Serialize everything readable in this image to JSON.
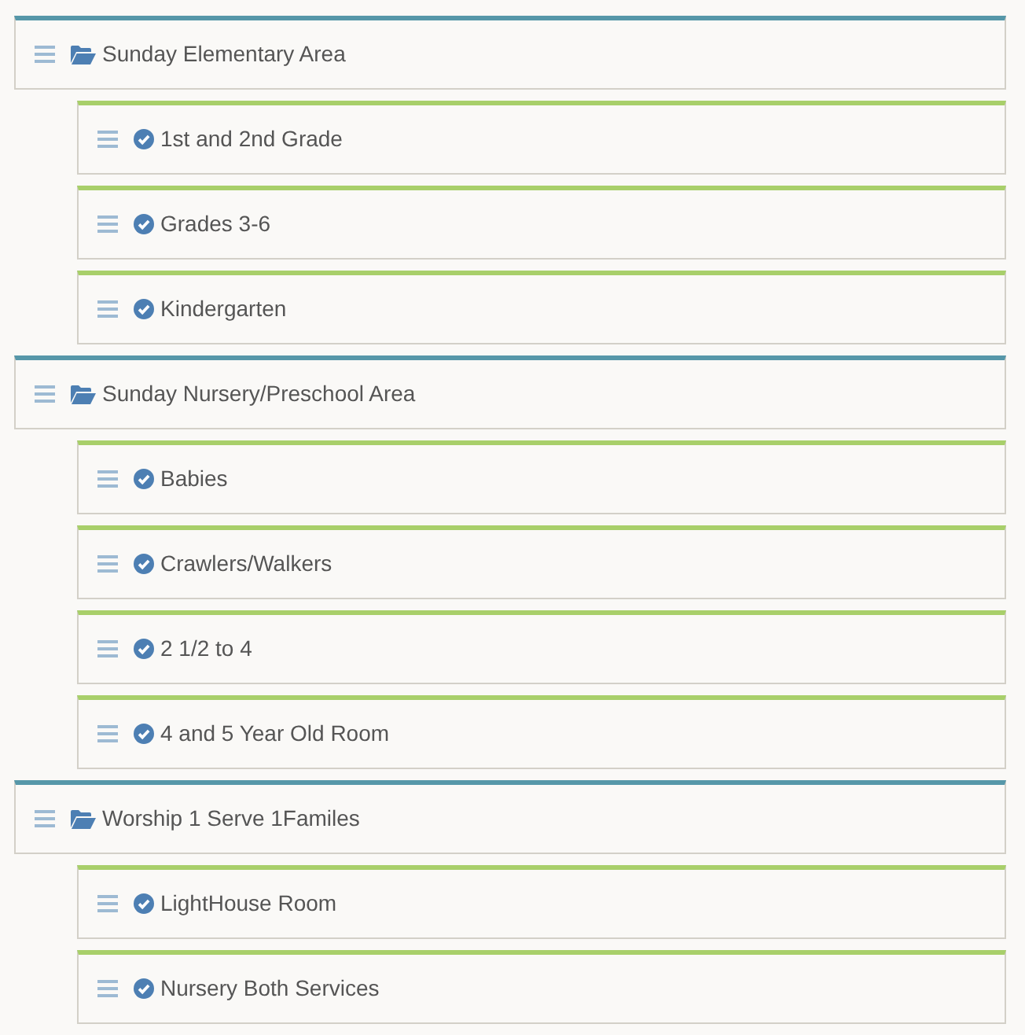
{
  "areas": [
    {
      "label": "Sunday Elementary Area",
      "children": [
        {
          "label": "1st and 2nd Grade"
        },
        {
          "label": "Grades 3-6"
        },
        {
          "label": "Kindergarten"
        }
      ]
    },
    {
      "label": "Sunday Nursery/Preschool Area",
      "children": [
        {
          "label": "Babies"
        },
        {
          "label": "Crawlers/Walkers"
        },
        {
          "label": "2 1/2 to 4"
        },
        {
          "label": "4 and 5 Year Old Room"
        }
      ]
    },
    {
      "label": "Worship 1 Serve 1Familes",
      "children": [
        {
          "label": "LightHouse Room"
        },
        {
          "label": "Nursery Both Services"
        }
      ]
    }
  ]
}
